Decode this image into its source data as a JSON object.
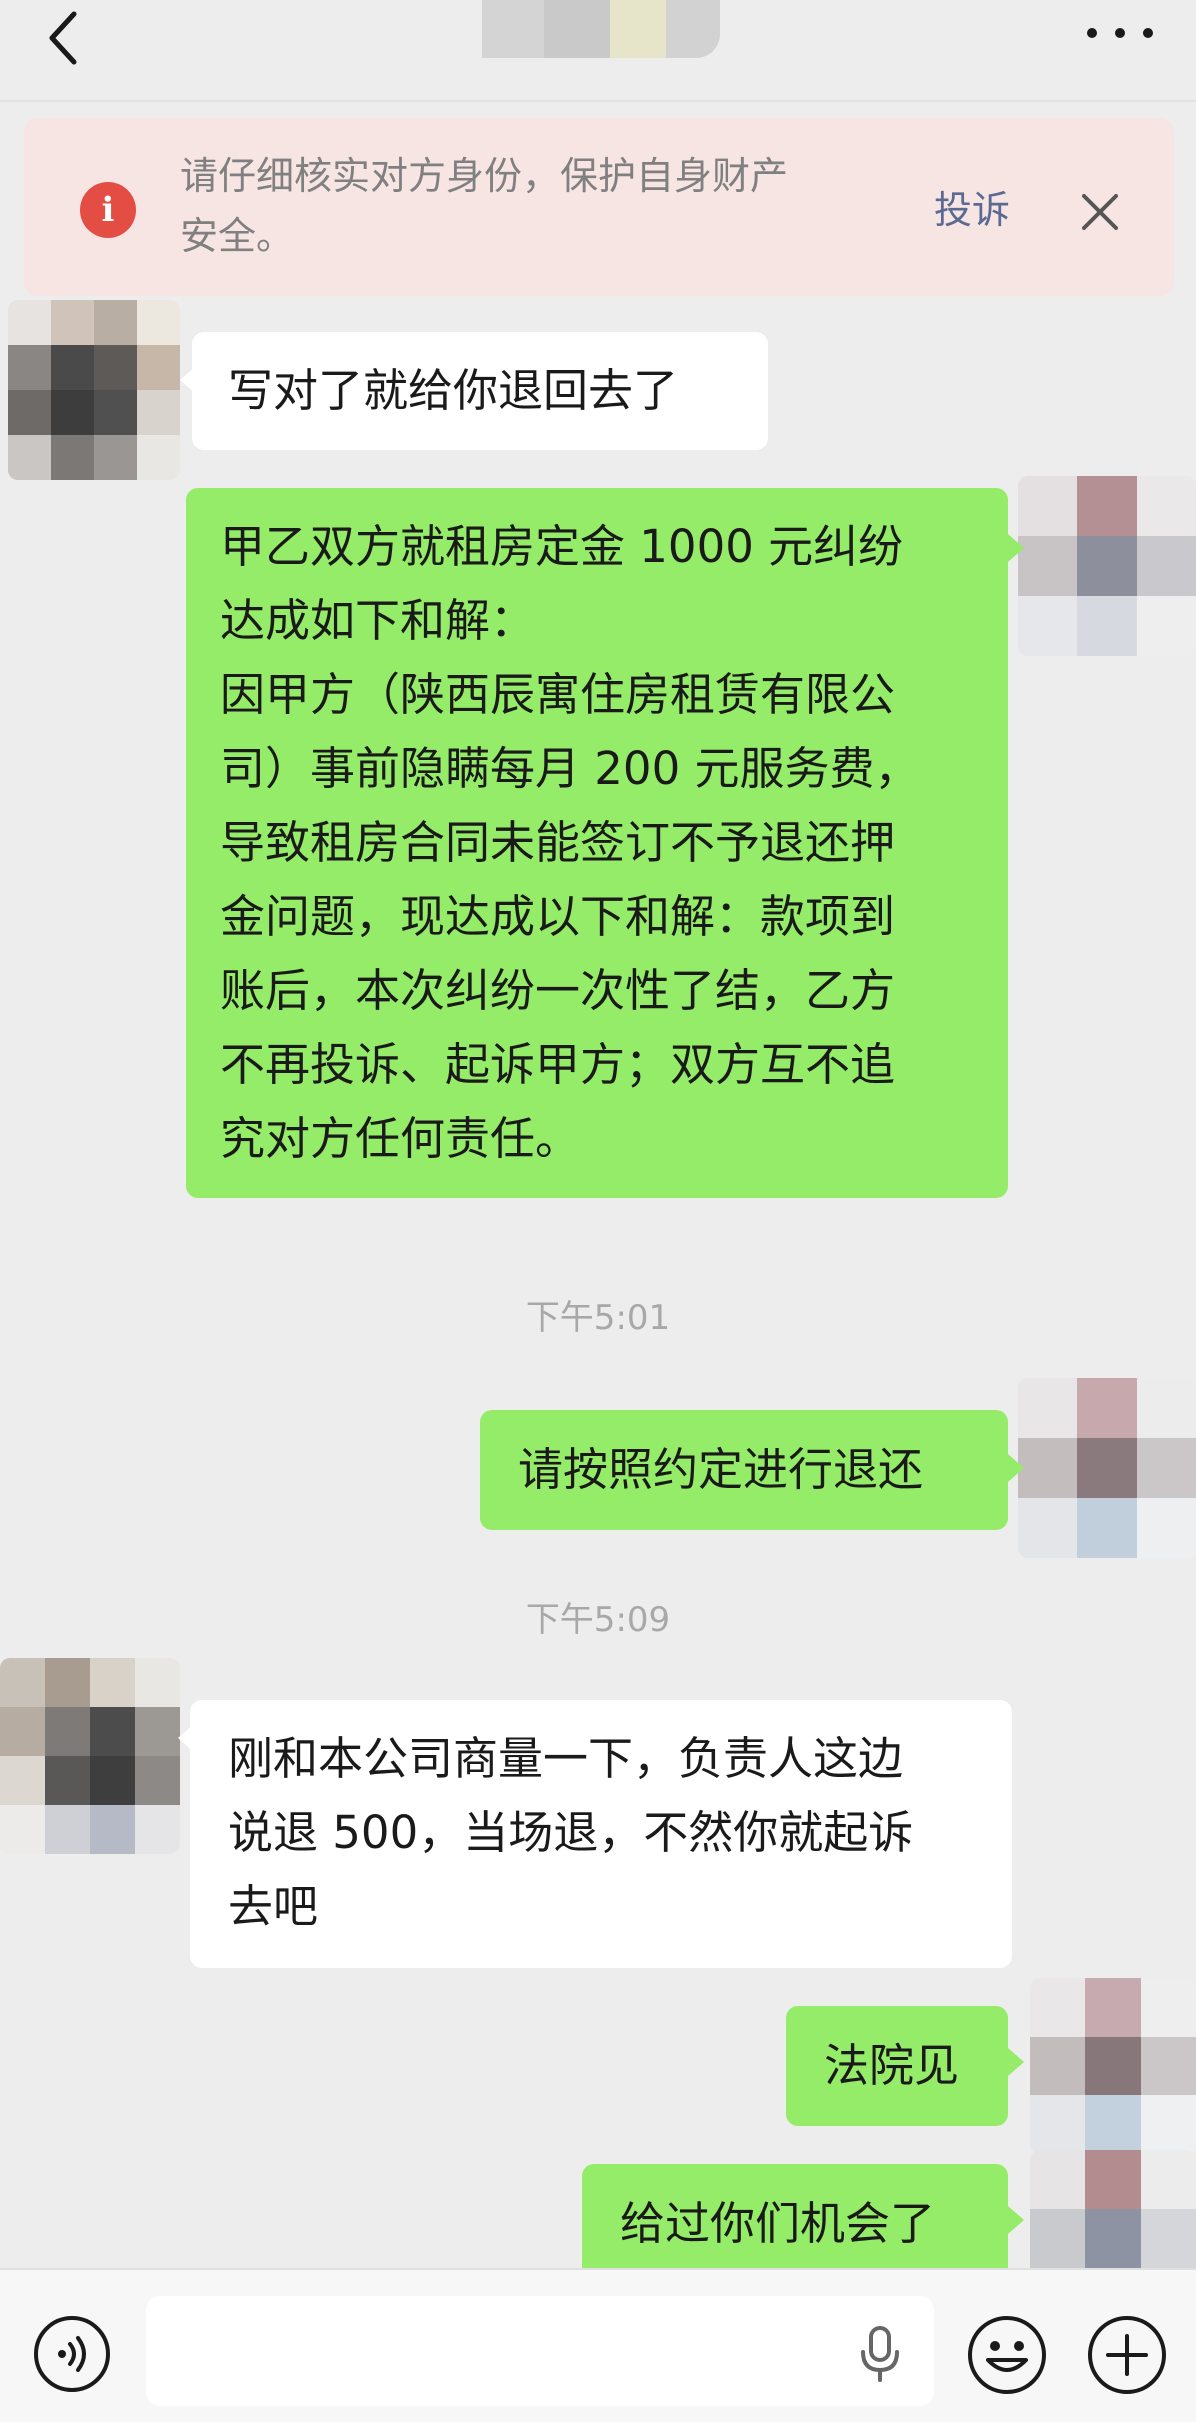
{
  "header": {
    "back_icon": "chevron-left-icon",
    "more_icon": "ellipsis-icon"
  },
  "warning": {
    "icon": "info-icon",
    "icon_glyph": "i",
    "text_line1": "请仔细核实对方身份，保护自身财产",
    "text_line2": "安全。",
    "complain_label": "投诉",
    "close_icon": "close-icon",
    "accent_color": "#e44d44"
  },
  "messages": [
    {
      "side": "left",
      "lines": [
        "写对了就给你退回去了"
      ]
    },
    {
      "side": "right",
      "lines": [
        "甲乙双方就租房定金 1000 元纠纷",
        "达成如下和解：",
        "因甲方（陕西辰寓住房租赁有限公",
        "司）事前隐瞒每月 200 元服务费，",
        "导致租房合同未能签订不予退还押",
        "金问题，现达成以下和解：款项到",
        "账后，本次纠纷一次性了结，乙方",
        "不再投诉、起诉甲方；双方互不追",
        "究对方任何责任。"
      ]
    },
    {
      "side": "right",
      "lines": [
        "请按照约定进行退还"
      ]
    },
    {
      "side": "left",
      "lines": [
        "刚和本公司商量一下，负责人这边",
        "说退 500，当场退，不然你就起诉",
        "去吧"
      ]
    },
    {
      "side": "right",
      "lines": [
        "法院见"
      ]
    },
    {
      "side": "right",
      "lines": [
        "给过你们机会了"
      ]
    }
  ],
  "timestamps": [
    "下午5:01",
    "下午5:09"
  ],
  "bottom_bar": {
    "voice_icon": "voice-icon",
    "mic_icon": "microphone-icon",
    "emoji_icon": "emoji-icon",
    "plus_icon": "plus-icon"
  },
  "colors": {
    "background": "#ededed",
    "bubble_sent": "#95ec69",
    "bubble_received": "#ffffff",
    "complain_link": "#5b6a92"
  }
}
